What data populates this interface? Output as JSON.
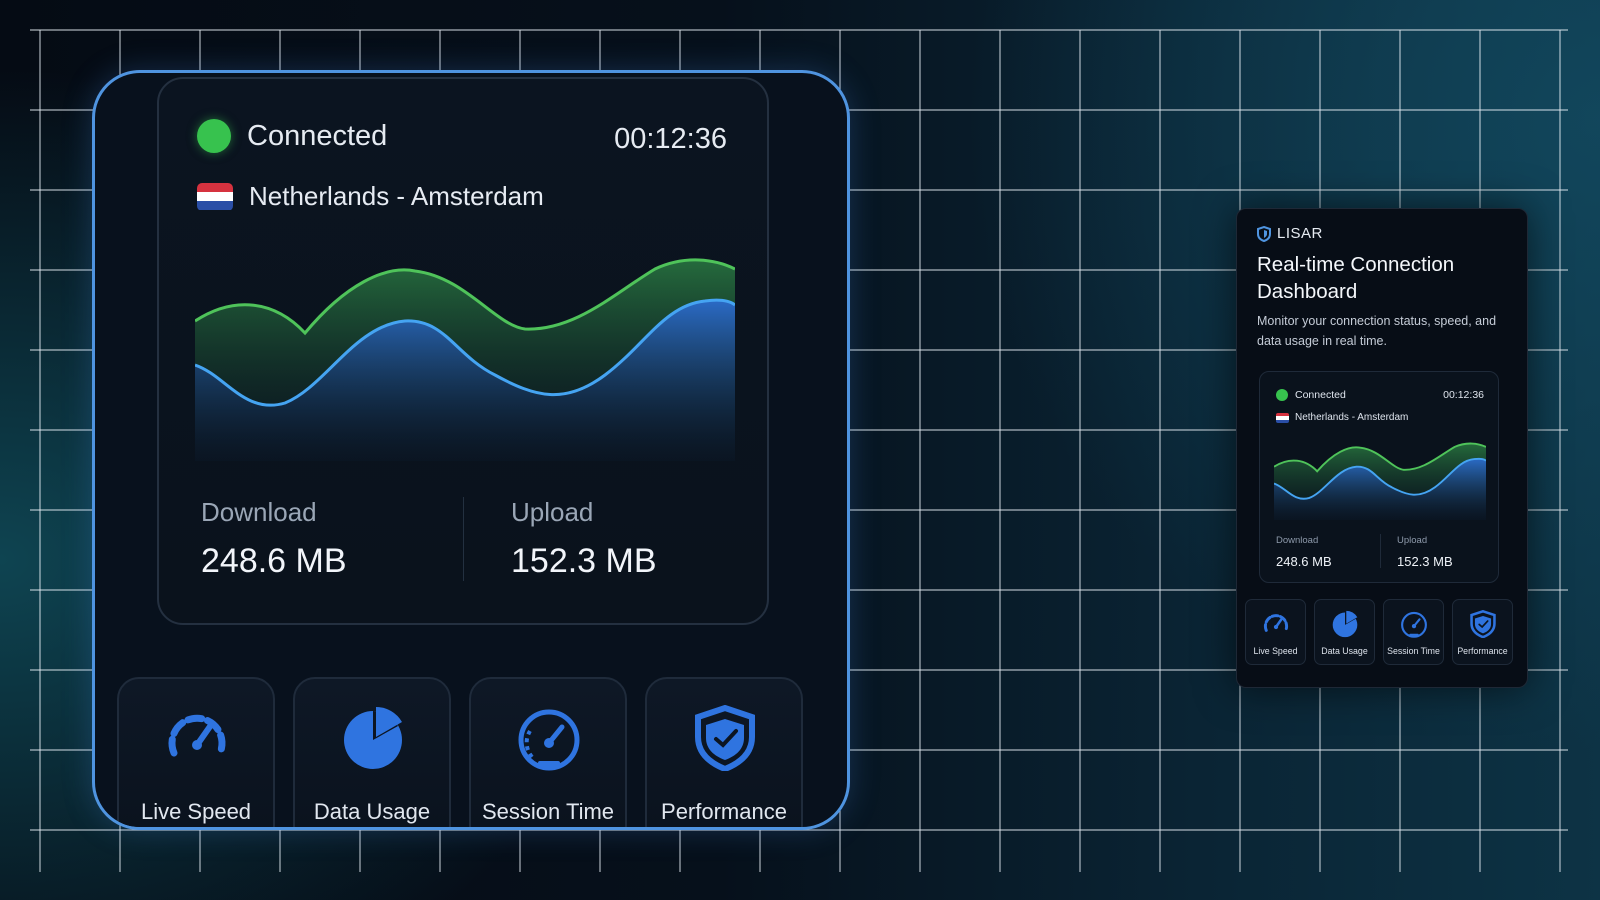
{
  "zoom": {
    "status_label": "Connected",
    "session_time": "00:12:36",
    "location": "Netherlands - Amsterdam",
    "download_label": "Download",
    "download_value": "248.6 MB",
    "upload_label": "Upload",
    "upload_value": "152.3 MB",
    "tiles": [
      {
        "label": "Live Speed",
        "icon": "speedometer-icon"
      },
      {
        "label": "Data Usage",
        "icon": "pie-chart-icon"
      },
      {
        "label": "Session Time",
        "icon": "gauge-icon"
      },
      {
        "label": "Performance",
        "icon": "shield-icon"
      }
    ]
  },
  "window": {
    "brand": "LISAR",
    "title": "Real-time Connection Dashboard",
    "description": "Monitor your connection status, speed, and data usage in real time.",
    "status_label": "Connected",
    "session_time": "00:12:36",
    "location": "Netherlands - Amsterdam",
    "download_label": "Download",
    "download_value": "248.6 MB",
    "upload_label": "Upload",
    "upload_value": "152.3 MB",
    "tiles": [
      {
        "label": "Live Speed",
        "icon": "speedometer-icon"
      },
      {
        "label": "Data Usage",
        "icon": "pie-chart-icon"
      },
      {
        "label": "Session Time",
        "icon": "gauge-icon"
      },
      {
        "label": "Performance",
        "icon": "shield-icon"
      }
    ]
  },
  "colors": {
    "accent": "#4f94e0",
    "connected": "#37c24e",
    "download_wave": "#4fc35a",
    "upload_wave": "#3c8dee",
    "icon_blue": "#2f74e0"
  }
}
